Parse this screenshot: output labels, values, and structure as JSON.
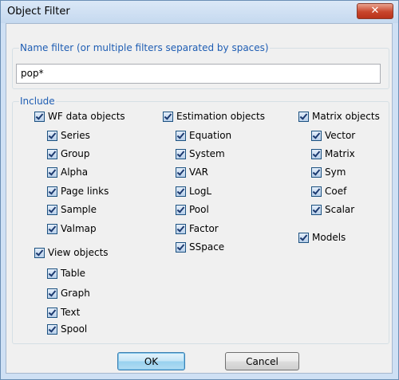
{
  "window": {
    "title": "Object Filter",
    "close_glyph": "✕"
  },
  "name_filter": {
    "label": "Name filter (or multiple filters separated by spaces)",
    "value": "pop*"
  },
  "include": {
    "label": "Include",
    "wf_data_objects": {
      "label": "WF data objects",
      "checked": true,
      "items": [
        "Series",
        "Group",
        "Alpha",
        "Page links",
        "Sample",
        "Valmap"
      ]
    },
    "view_objects": {
      "label": "View objects",
      "checked": true,
      "items": [
        "Table",
        "Graph",
        "Text",
        "Spool"
      ]
    },
    "estimation_objects": {
      "label": "Estimation objects",
      "checked": true,
      "items": [
        "Equation",
        "System",
        "VAR",
        "LogL",
        "Pool",
        "Factor",
        "SSpace"
      ]
    },
    "matrix_objects": {
      "label": "Matrix objects",
      "checked": true,
      "items": [
        "Vector",
        "Matrix",
        "Sym",
        "Coef",
        "Scalar"
      ]
    },
    "models": {
      "label": "Models",
      "checked": true
    }
  },
  "buttons": {
    "ok": "OK",
    "cancel": "Cancel"
  },
  "colors": {
    "group_label": "#1e5db3",
    "title_bar": "#c5d9ef",
    "close_button": "#c8452b"
  }
}
